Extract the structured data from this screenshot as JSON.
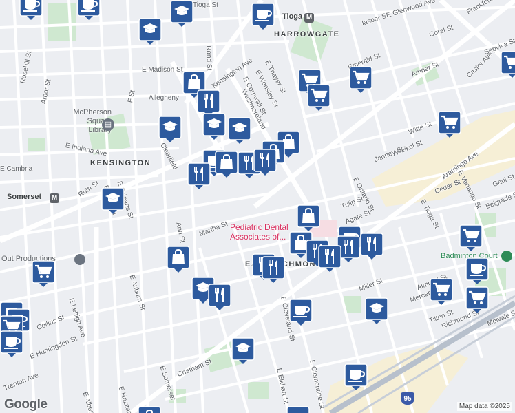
{
  "map": {
    "neighborhoods": [
      "HARROWGATE",
      "KENSINGTON",
      "EAST RICHMOND"
    ],
    "street_labels": [
      "Rand St",
      "Tioga St",
      "E Glenwood Ave",
      "Frankford",
      "Jasper St",
      "Coral St",
      "Ruth St",
      "E Madison St",
      "Rosehill St",
      "Arbor St",
      "F St",
      "Kensington Ave",
      "E Thayer St",
      "E Wensley St",
      "E Cornwall St",
      "Westmoreland",
      "Emerald St",
      "Amber St",
      "Castor Ave",
      "Sepviva St",
      "Witte St",
      "Weikel St",
      "Janney St",
      "E Ontario St",
      "Aramingo Ave",
      "Tulip St",
      "Agate St",
      "E Tioga St",
      "E Venango St",
      "Gaul St",
      "Belgrade St",
      "Cedar St",
      "E Indiana Ave",
      "Clearfield",
      "E Orleans St",
      "E Birch St",
      "Martha St",
      "Ann St",
      "E Lehigh Ave",
      "Collins St",
      "E Huntingdon St",
      "E Auburn St",
      "Miller St",
      "Almond St",
      "Mercer St",
      "Richmond St",
      "Melvale St",
      "Tilton St",
      "Chatham St",
      "E Elkhart St",
      "E Clementine St",
      "E Hazzard St",
      "E Albert St",
      "E Somerset",
      "Trenton Ave",
      "E Cambria",
      "Allegheny",
      "E Cleveland St"
    ],
    "places": {
      "library": "McPherson Square Library",
      "dental": "Pediatric Dental Associates of...",
      "productions": "Out Productions",
      "badminton": "Badminton Court"
    },
    "transit": [
      {
        "label": "Tioga",
        "icon": "subway-icon"
      },
      {
        "label": "Somerset",
        "icon": "subway-icon"
      }
    ],
    "interstate": "95",
    "google_logo": "Google",
    "attribution": "Map data ©2025",
    "colors": {
      "marker": "#2d5a9e",
      "street": "#ffffff",
      "park": "#cfe8d0",
      "industrial": "#f6efd6",
      "highway": "#b7c0cc"
    },
    "marker_icons": [
      "graduation-cap-icon",
      "coffee-cup-icon",
      "shopping-bag-icon",
      "fork-knife-icon",
      "shopping-cart-icon"
    ]
  }
}
